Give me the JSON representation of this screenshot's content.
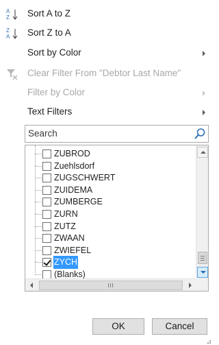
{
  "menu": {
    "sort_az": {
      "label": "Sort A to Z",
      "icon": "sort-az-icon"
    },
    "sort_za": {
      "label": "Sort Z to A",
      "icon": "sort-za-icon"
    },
    "sort_color": {
      "label": "Sort by Color"
    },
    "clear_filter": {
      "label": "Clear Filter From \"Debtor Last Name\"",
      "icon": "clear-filter-icon"
    },
    "filter_color": {
      "label": "Filter by Color"
    },
    "text_filters": {
      "label": "Text Filters"
    }
  },
  "search": {
    "placeholder": "Search",
    "icon": "search-icon"
  },
  "list": {
    "items": [
      {
        "label": "ZUBROD",
        "checked": false
      },
      {
        "label": "Zuehlsdorf",
        "checked": false
      },
      {
        "label": "ZUGSCHWERT",
        "checked": false
      },
      {
        "label": "ZUIDEMA",
        "checked": false
      },
      {
        "label": "ZUMBERGE",
        "checked": false
      },
      {
        "label": "ZURN",
        "checked": false
      },
      {
        "label": "ZUTZ",
        "checked": false
      },
      {
        "label": "ZWAAN",
        "checked": false
      },
      {
        "label": "ZWIEFEL",
        "checked": false
      },
      {
        "label": "ZYCH",
        "checked": true,
        "selected": true
      },
      {
        "label": "(Blanks)",
        "checked": false
      }
    ],
    "hscroll_label": "III"
  },
  "buttons": {
    "ok": "OK",
    "cancel": "Cancel"
  },
  "colors": {
    "selection": "#3399ff",
    "disabled_text": "#a8a8a8",
    "sort_arrow": "#2f6fb7"
  }
}
